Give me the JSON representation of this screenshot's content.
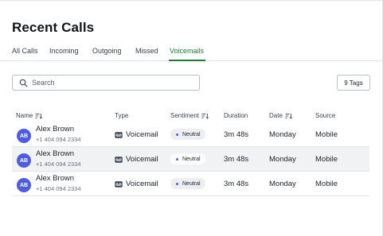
{
  "page": {
    "title": "Recent Calls"
  },
  "tabs": [
    {
      "label": "All Calls"
    },
    {
      "label": "Incoming"
    },
    {
      "label": "Outgoing"
    },
    {
      "label": "Missed"
    },
    {
      "label": "Voicemails",
      "active": true
    }
  ],
  "search": {
    "placeholder": "Search"
  },
  "tags_button": {
    "label": "9 Tags"
  },
  "table": {
    "columns": [
      {
        "label": "Name",
        "sortable": true
      },
      {
        "label": "Type",
        "sortable": false
      },
      {
        "label": "Sentiment",
        "sortable": true
      },
      {
        "label": "Duration",
        "sortable": false
      },
      {
        "label": "Date",
        "sortable": true
      },
      {
        "label": "Source",
        "sortable": false
      }
    ],
    "rows": [
      {
        "initials": "AB",
        "name": "Alex Brown",
        "phone": "+1 404 094 2334",
        "type": "Voicemail",
        "sentiment": "Neutral",
        "duration": "3m 48s",
        "date": "Monday",
        "source": "Mobile",
        "highlighted": false
      },
      {
        "initials": "AB",
        "name": "Alex Brown",
        "phone": "+1 404 094 2334",
        "type": "Voicemail",
        "sentiment": "Neutral",
        "duration": "3m 48s",
        "date": "Monday",
        "source": "Mobile",
        "highlighted": true
      },
      {
        "initials": "AB",
        "name": "Alex Brown",
        "phone": "+1 404 094 2334",
        "type": "Voicemail",
        "sentiment": "Neutral",
        "duration": "3m 48s",
        "date": "Monday",
        "source": "Mobile",
        "highlighted": false
      }
    ]
  },
  "icons": {
    "search": "search-icon",
    "sort": "sort-icon",
    "voicemail": "voicemail-icon"
  },
  "colors": {
    "accent_green": "#1e7a3c",
    "avatar_blue": "#4f5ddb",
    "row_highlight": "#f0f2f4",
    "badge_bg": "#eceef1"
  }
}
